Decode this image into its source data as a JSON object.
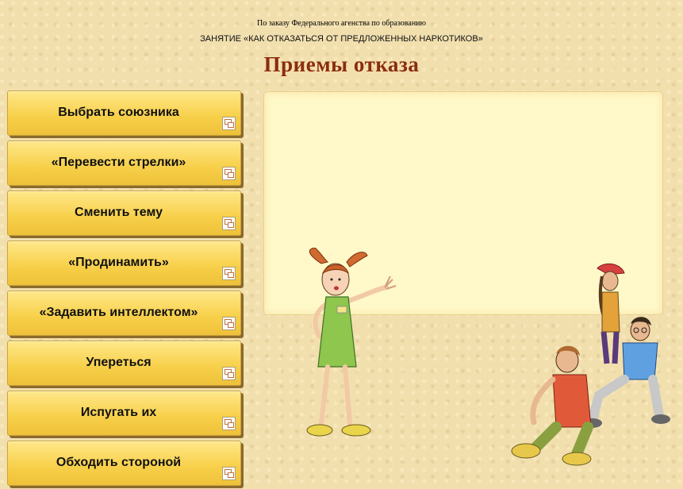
{
  "header": {
    "sponsor": "По заказу Федерального агенства по образованию",
    "lesson": "ЗАНЯТИЕ «КАК ОТКАЗАТЬСЯ ОТ ПРЕДЛОЖЕННЫХ НАРКОТИКОВ»",
    "title": "Приемы отказа"
  },
  "menu": {
    "items": [
      {
        "label": "Выбрать союзника"
      },
      {
        "label": "«Перевести стрелки»"
      },
      {
        "label": "Сменить тему"
      },
      {
        "label": "«Продинамить»"
      },
      {
        "label": "«Задавить интеллектом»"
      },
      {
        "label": "Упереться"
      },
      {
        "label": "Испугать их"
      },
      {
        "label": "Обходить стороной"
      }
    ]
  },
  "colors": {
    "background": "#f1dfae",
    "title": "#8a2d0e",
    "button": "#f7cf48",
    "panel": "#fff8c8"
  }
}
